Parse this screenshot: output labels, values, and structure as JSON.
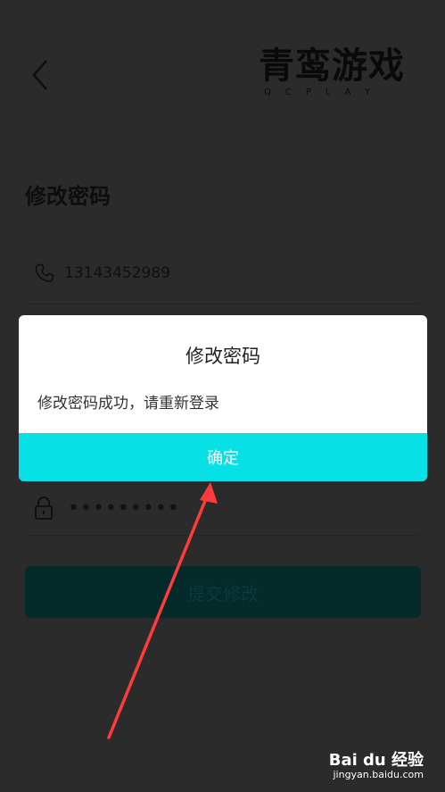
{
  "header": {
    "logo_main": "青鸾游戏",
    "logo_sub": "QCPLAY"
  },
  "page": {
    "title": "修改密码"
  },
  "form": {
    "phone": "13143452989",
    "password_mask": "•••••••••",
    "submit_label": "提交修改"
  },
  "dialog": {
    "title": "修改密码",
    "message": "修改密码成功，请重新登录",
    "confirm_label": "确定"
  },
  "watermark": {
    "brand": "Bai du 经验",
    "url": "jingyan.baidu.com"
  },
  "colors": {
    "overlay_background": "#2b2b2b",
    "dialog_background": "#ffffff",
    "confirm_button": "#07e0e4",
    "annotation_arrow": "#ff3b3b"
  }
}
